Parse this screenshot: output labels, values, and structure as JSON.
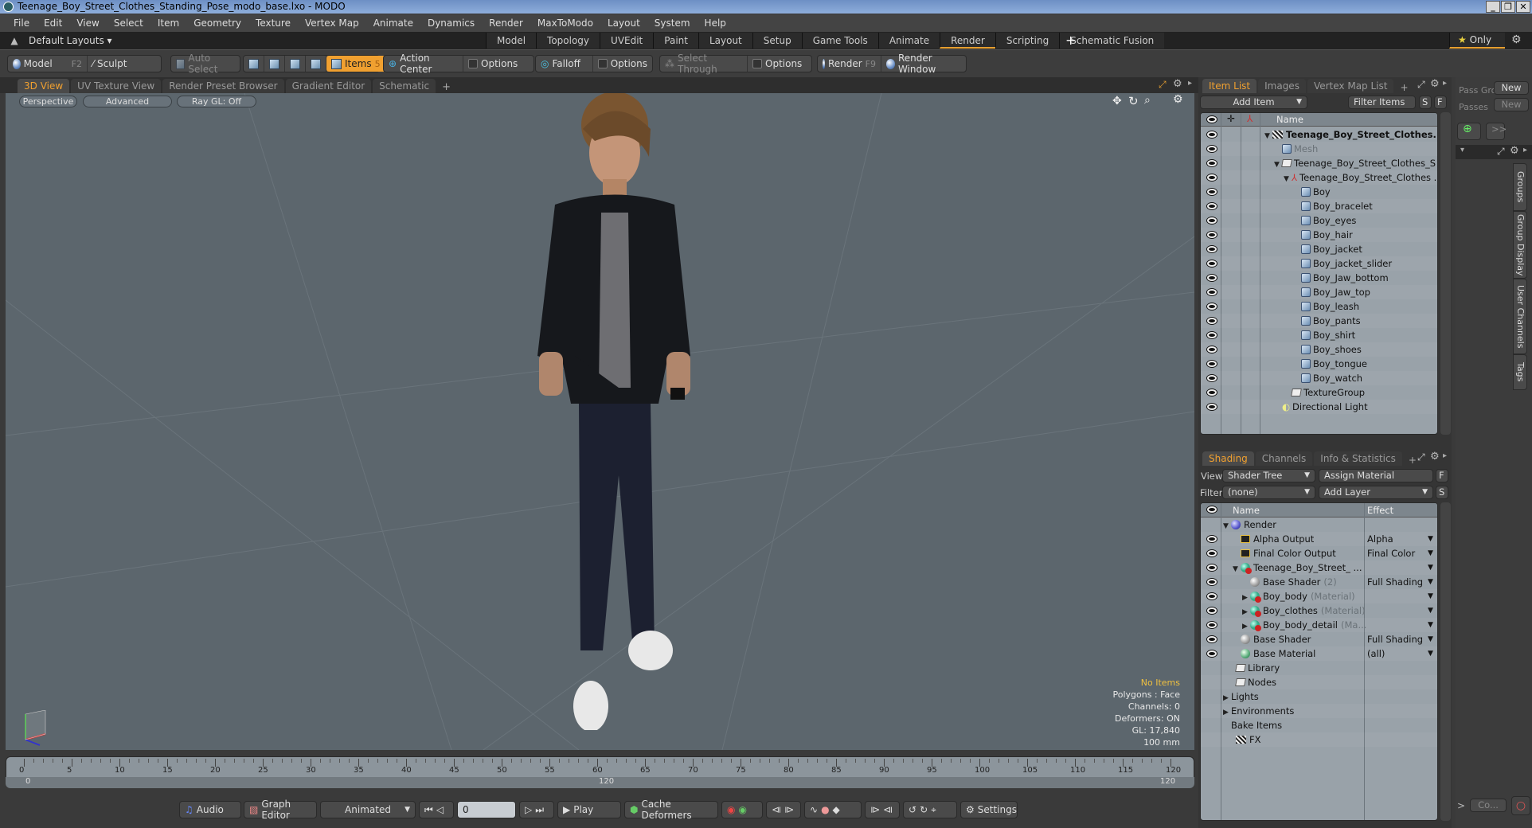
{
  "window": {
    "title": "Teenage_Boy_Street_Clothes_Standing_Pose_modo_base.lxo - MODO",
    "minimize": "_",
    "restore": "❐",
    "close": "✕"
  },
  "menu": [
    "File",
    "Edit",
    "View",
    "Select",
    "Item",
    "Geometry",
    "Texture",
    "Vertex Map",
    "Animate",
    "Dynamics",
    "Render",
    "MaxToModo",
    "Layout",
    "System",
    "Help"
  ],
  "layouts": {
    "dropdown": "Default Layouts ▾",
    "tabs": [
      "Model",
      "Topology",
      "UVEdit",
      "Paint",
      "Layout",
      "Setup",
      "Game Tools",
      "Animate",
      "Render",
      "Scripting",
      "Schematic Fusion"
    ],
    "active": "Render",
    "add": "+",
    "only": "Only"
  },
  "toolbar": {
    "model": "Model",
    "model_key": "F2",
    "sculpt": "Sculpt",
    "auto_select": "Auto Select",
    "items": "Items",
    "items_key": "5",
    "action_center": "Action Center",
    "options1": "Options",
    "falloff": "Falloff",
    "options2": "Options",
    "select_through": "Select Through",
    "options3": "Options",
    "render": "Render",
    "render_key": "F9",
    "render_window": "Render Window"
  },
  "viewport_tabs": {
    "tabs": [
      "3D View",
      "UV Texture View",
      "Render Preset Browser",
      "Gradient Editor",
      "Schematic"
    ],
    "active": "3D View",
    "add": "+"
  },
  "viewport": {
    "buttons": [
      "Perspective",
      "Advanced",
      "Ray GL: Off"
    ],
    "info": {
      "selection": "No Items",
      "polygons": "Polygons : Face",
      "channels": "Channels: 0",
      "deformers": "Deformers: ON",
      "gl": "GL: 17,840",
      "unit": "100 mm"
    },
    "accent": "#f0c040"
  },
  "timeline": {
    "ticks": [
      "0",
      "5",
      "10",
      "15",
      "20",
      "25",
      "30",
      "35",
      "40",
      "45",
      "50",
      "55",
      "60",
      "65",
      "70",
      "75",
      "80",
      "85",
      "90",
      "95",
      "100",
      "105",
      "110",
      "115",
      "120"
    ],
    "range_start": "0",
    "range_mid": "120",
    "range_end": "120"
  },
  "transport": {
    "audio": "Audio",
    "graph_editor": "Graph Editor",
    "mode": "Animated",
    "frame": "0",
    "play": "Play",
    "cache": "Cache Deformers",
    "settings": "Settings"
  },
  "item_list": {
    "tabs": [
      "Item List",
      "Images",
      "Vertex Map List"
    ],
    "active": "Item List",
    "add": "+",
    "add_item": "Add Item",
    "filter": "Filter Items",
    "s": "S",
    "f": "F",
    "header_name": "Name",
    "rows": [
      {
        "label": "Teenage_Boy_Street_Clothes...",
        "type": "scene",
        "depth": 0,
        "expand": "▼",
        "bold": true
      },
      {
        "label": "Mesh",
        "type": "mesh",
        "depth": 1,
        "expand": "",
        "dim": true
      },
      {
        "label": "Teenage_Boy_Street_Clothes_S ...",
        "type": "group",
        "depth": 1,
        "expand": "▼"
      },
      {
        "label": "Teenage_Boy_Street_Clothes ...",
        "type": "locator",
        "depth": 2,
        "expand": "▼"
      },
      {
        "label": "Boy",
        "type": "mesh",
        "depth": 3
      },
      {
        "label": "Boy_bracelet",
        "type": "mesh",
        "depth": 3
      },
      {
        "label": "Boy_eyes",
        "type": "mesh",
        "depth": 3
      },
      {
        "label": "Boy_hair",
        "type": "mesh",
        "depth": 3
      },
      {
        "label": "Boy_jacket",
        "type": "mesh",
        "depth": 3
      },
      {
        "label": "Boy_jacket_slider",
        "type": "mesh",
        "depth": 3
      },
      {
        "label": "Boy_Jaw_bottom",
        "type": "mesh",
        "depth": 3
      },
      {
        "label": "Boy_Jaw_top",
        "type": "mesh",
        "depth": 3
      },
      {
        "label": "Boy_leash",
        "type": "mesh",
        "depth": 3
      },
      {
        "label": "Boy_pants",
        "type": "mesh",
        "depth": 3
      },
      {
        "label": "Boy_shirt",
        "type": "mesh",
        "depth": 3
      },
      {
        "label": "Boy_shoes",
        "type": "mesh",
        "depth": 3
      },
      {
        "label": "Boy_tongue",
        "type": "mesh",
        "depth": 3
      },
      {
        "label": "Boy_watch",
        "type": "mesh",
        "depth": 3
      },
      {
        "label": "TextureGroup",
        "type": "group",
        "depth": 2
      },
      {
        "label": "Directional Light",
        "type": "light",
        "depth": 1
      }
    ]
  },
  "passes": {
    "pass_groups": "Pass Gro",
    "passes": "Passes",
    "new1": "New",
    "new2": "New",
    "more": ">>"
  },
  "side_tabs": [
    "Groups",
    "Group Display",
    "User Channels",
    "Tags"
  ],
  "shading": {
    "tabs": [
      "Shading",
      "Channels",
      "Info & Statistics"
    ],
    "active": "Shading",
    "add": "+",
    "view_label": "View",
    "view_value": "Shader Tree",
    "assign_material": "Assign Material",
    "f": "F",
    "filter_label": "Filter",
    "filter_value": "(none)",
    "add_layer": "Add Layer",
    "s": "S",
    "header_name": "Name",
    "header_effect": "Effect",
    "rows": [
      {
        "label": "Render",
        "suffix": "",
        "icon": "render",
        "depth": 0,
        "expand": "▼",
        "effect": "",
        "eye": false
      },
      {
        "label": "Alpha Output",
        "suffix": "",
        "icon": "output",
        "depth": 1,
        "effect": "Alpha",
        "eye": true,
        "dd": true
      },
      {
        "label": "Final Color Output",
        "suffix": "",
        "icon": "output",
        "depth": 1,
        "effect": "Final Color",
        "eye": true,
        "dd": true
      },
      {
        "label": "Teenage_Boy_Street_ ...",
        "suffix": "",
        "icon": "material",
        "depth": 1,
        "expand": "▼",
        "effect": "",
        "eye": true,
        "dd": true
      },
      {
        "label": "Base Shader",
        "suffix": "(2)",
        "icon": "shader",
        "depth": 2,
        "effect": "Full Shading",
        "eye": true,
        "dd": true
      },
      {
        "label": "Boy_body",
        "suffix": "(Material)",
        "icon": "material",
        "depth": 2,
        "expand": "▶",
        "effect": "",
        "eye": true,
        "dd": true
      },
      {
        "label": "Boy_clothes",
        "suffix": "(Material)",
        "icon": "material",
        "depth": 2,
        "expand": "▶",
        "effect": "",
        "eye": true,
        "dd": true
      },
      {
        "label": "Boy_body_detail",
        "suffix": "(Ma...",
        "icon": "material",
        "depth": 2,
        "expand": "▶",
        "effect": "",
        "eye": true,
        "dd": true
      },
      {
        "label": "Base Shader",
        "suffix": "",
        "icon": "shader",
        "depth": 1,
        "effect": "Full Shading",
        "eye": true,
        "dd": true
      },
      {
        "label": "Base Material",
        "suffix": "",
        "icon": "basemat",
        "depth": 1,
        "effect": "(all)",
        "eye": true,
        "dd": true
      },
      {
        "label": "Library",
        "suffix": "",
        "icon": "folder",
        "depth": 0.5,
        "effect": "",
        "eye": false
      },
      {
        "label": "Nodes",
        "suffix": "",
        "icon": "folder",
        "depth": 0.5,
        "effect": "",
        "eye": false
      },
      {
        "label": "Lights",
        "suffix": "",
        "icon": "",
        "depth": 0,
        "expand": "▶",
        "effect": "",
        "eye": false
      },
      {
        "label": "Environments",
        "suffix": "",
        "icon": "",
        "depth": 0,
        "expand": "▶",
        "effect": "",
        "eye": false
      },
      {
        "label": "Bake Items",
        "suffix": "",
        "icon": "",
        "depth": 0,
        "effect": "",
        "eye": false
      },
      {
        "label": "FX",
        "suffix": "",
        "icon": "fx",
        "depth": 0.5,
        "effect": "",
        "eye": false
      }
    ]
  },
  "command": {
    "prompt": ">",
    "input": "Co..."
  }
}
